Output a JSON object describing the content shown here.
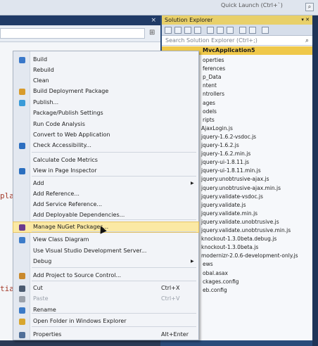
{
  "window": {
    "quick_launch_placeholder": "Quick Launch (Ctrl+`)"
  },
  "editor": {
    "code_fragments": [
      "pla",
      "tia"
    ]
  },
  "solution_explorer": {
    "title": "Solution Explorer",
    "search_placeholder": "Search Solution Explorer (Ctrl+;)",
    "project_name": "MvcApplication5",
    "items": [
      "operties",
      "ferences",
      "p_Data",
      "ntent",
      "ntrollers",
      "ages",
      "odels",
      "ripts",
      "AjaxLogin.js",
      "jquery-1.6.2-vsdoc.js",
      "jquery-1.6.2.js",
      "jquery-1.6.2.min.js",
      "jquery-ui-1.8.11.js",
      "jquery-ui-1.8.11.min.js",
      "jquery.unobtrusive-ajax.js",
      "jquery.unobtrusive-ajax.min.js",
      "jquery.validate-vsdoc.js",
      "jquery.validate.js",
      "jquery.validate.min.js",
      "jquery.validate.unobtrusive.js",
      "jquery.validate.unobtrusive.min.js",
      "knockout-1.3.0beta.debug.js",
      "knockout-1.3.0beta.js",
      "modernizr-2.0.6-development-only.js",
      "ews",
      "obal.asax",
      "ckages.config",
      "eb.config"
    ]
  },
  "context_menu": {
    "items": [
      {
        "label": "Build",
        "icon": "build-icon"
      },
      {
        "label": "Rebuild"
      },
      {
        "label": "Clean"
      },
      {
        "label": "Build Deployment Package",
        "icon": "package-icon"
      },
      {
        "label": "Publish...",
        "icon": "publish-icon"
      },
      {
        "label": "Package/Publish Settings"
      },
      {
        "label": "Run Code Analysis"
      },
      {
        "label": "Convert to Web Application"
      },
      {
        "label": "Check Accessibility...",
        "icon": "accessibility-icon"
      },
      {
        "label": "Calculate Code Metrics"
      },
      {
        "label": "View in Page Inspector",
        "icon": "inspector-icon"
      },
      {
        "label": "Add",
        "submenu": true
      },
      {
        "label": "Add Reference..."
      },
      {
        "label": "Add Service Reference..."
      },
      {
        "label": "Add Deployable Dependencies..."
      },
      {
        "label": "Manage NuGet Packages...",
        "icon": "nuget-icon",
        "highlighted": true
      },
      {
        "label": "View Class Diagram",
        "icon": "class-diagram-icon"
      },
      {
        "label": "Use Visual Studio Development Server..."
      },
      {
        "label": "Debug",
        "submenu": true
      },
      {
        "label": "Add Project to Source Control...",
        "icon": "source-control-icon"
      },
      {
        "label": "Cut",
        "shortcut": "Ctrl+X",
        "icon": "cut-icon"
      },
      {
        "label": "Paste",
        "shortcut": "Ctrl+V",
        "icon": "paste-icon",
        "disabled": true
      },
      {
        "label": "Rename",
        "icon": "rename-icon"
      },
      {
        "label": "Open Folder in Windows Explorer",
        "icon": "folder-icon"
      },
      {
        "label": "Properties",
        "shortcut": "Alt+Enter",
        "icon": "properties-icon"
      }
    ]
  },
  "colors": {
    "accent": "#efc84a",
    "highlight": "#fbe9a4",
    "chrome_dark": "#1f3458"
  }
}
